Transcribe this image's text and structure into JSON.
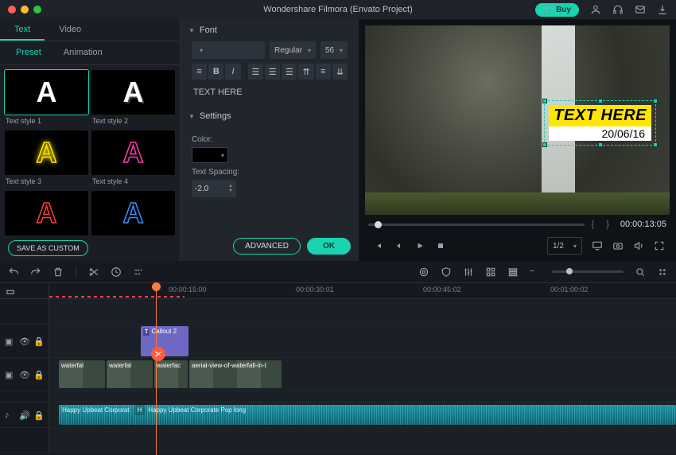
{
  "titlebar": {
    "title": "Wondershare Filmora (Envato Project)",
    "buy": "Buy"
  },
  "tabs": {
    "text": "Text",
    "video": "Video"
  },
  "subtabs": {
    "preset": "Preset",
    "animation": "Animation"
  },
  "styles": [
    {
      "label": "Text style 1"
    },
    {
      "label": "Text style 2"
    },
    {
      "label": "Text style 3"
    },
    {
      "label": "Text style 4"
    }
  ],
  "save_custom": "SAVE AS CUSTOM",
  "font": {
    "header": "Font",
    "weight": "Regular",
    "size": "56",
    "sample": "TEXT HERE"
  },
  "settings": {
    "header": "Settings",
    "color_label": "Color:",
    "spacing_label": "Text Spacing:",
    "spacing_value": "-2.0"
  },
  "buttons": {
    "advanced": "ADVANCED",
    "ok": "OK"
  },
  "preview": {
    "overlay_title": "TEXT HERE",
    "overlay_date": "20/06/16",
    "timecode": "00:00:13:05",
    "ratio": "1/2"
  },
  "ruler": [
    "00:00:15:00",
    "00:00:30:01",
    "00:00:45:02",
    "00:01:00:02"
  ],
  "clips": {
    "text": "Callout 2",
    "v1a": "waterfal",
    "v1b": "waterfal",
    "v1c": "waterfac",
    "v2": "aerial-view-of-waterfall-in-t",
    "a1": "Happy Upbeat Corporat",
    "a2": "H",
    "a3": "Happy Upbeat Corporate Pop long"
  }
}
